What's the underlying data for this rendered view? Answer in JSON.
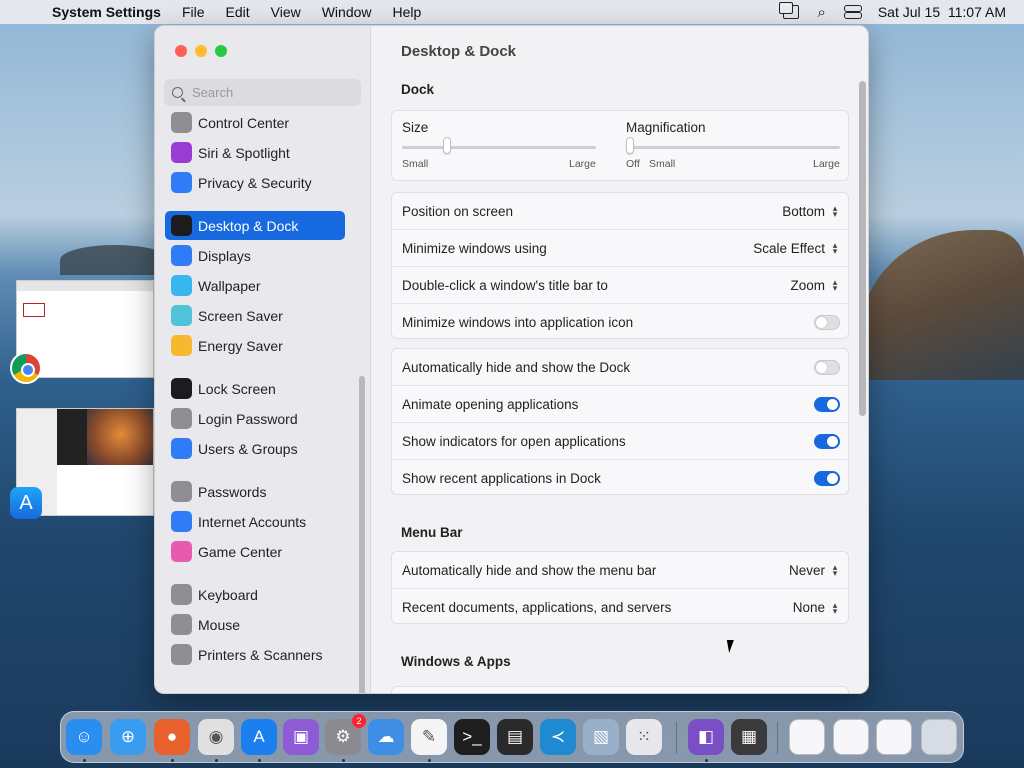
{
  "menubar": {
    "app_name": "System Settings",
    "items": [
      "File",
      "Edit",
      "View",
      "Window",
      "Help"
    ],
    "datetime": "Sat Jul 15  11:07 AM"
  },
  "sidebar": {
    "search_placeholder": "Search",
    "items": [
      {
        "label": "Control Center",
        "icon": "control-center-icon",
        "color": "#8e8e93"
      },
      {
        "label": "Siri & Spotlight",
        "icon": "siri-icon",
        "color": "#9b3bd6"
      },
      {
        "label": "Privacy & Security",
        "icon": "hand-icon",
        "color": "#2f7cf6"
      },
      {
        "label": "Desktop & Dock",
        "icon": "dock-icon",
        "color": "#1c1c1e",
        "selected": true
      },
      {
        "label": "Displays",
        "icon": "sun-icon",
        "color": "#2f7cf6"
      },
      {
        "label": "Wallpaper",
        "icon": "wallpaper-icon",
        "color": "#38b6f0"
      },
      {
        "label": "Screen Saver",
        "icon": "screen-saver-icon",
        "color": "#4fc3d9"
      },
      {
        "label": "Energy Saver",
        "icon": "bulb-icon",
        "color": "#f5b82e"
      },
      {
        "label": "Lock Screen",
        "icon": "lock-icon",
        "color": "#1c1c1e"
      },
      {
        "label": "Login Password",
        "icon": "login-lock-icon",
        "color": "#8e8e93"
      },
      {
        "label": "Users & Groups",
        "icon": "users-icon",
        "color": "#2f7cf6"
      },
      {
        "label": "Passwords",
        "icon": "key-icon",
        "color": "#8e8e93"
      },
      {
        "label": "Internet Accounts",
        "icon": "at-icon",
        "color": "#2f7cf6"
      },
      {
        "label": "Game Center",
        "icon": "game-center-icon",
        "color": "#e85ab0"
      },
      {
        "label": "Keyboard",
        "icon": "keyboard-icon",
        "color": "#8e8e93"
      },
      {
        "label": "Mouse",
        "icon": "mouse-icon",
        "color": "#8e8e93"
      },
      {
        "label": "Printers & Scanners",
        "icon": "printer-icon",
        "color": "#8e8e93"
      }
    ]
  },
  "content": {
    "title": "Desktop & Dock",
    "dock_section": "Dock",
    "size_label": "Size",
    "size_small": "Small",
    "size_large": "Large",
    "size_value": 0.23,
    "magnification_label": "Magnification",
    "mag_off": "Off",
    "mag_small": "Small",
    "mag_large": "Large",
    "mag_value": 0.0,
    "rows_group1": [
      {
        "label": "Position on screen",
        "value": "Bottom",
        "type": "popup"
      },
      {
        "label": "Minimize windows using",
        "value": "Scale Effect",
        "type": "popup"
      },
      {
        "label": "Double-click a window's title bar to",
        "value": "Zoom",
        "type": "popup"
      },
      {
        "label": "Minimize windows into application icon",
        "on": false,
        "type": "toggle"
      }
    ],
    "rows_group2": [
      {
        "label": "Automatically hide and show the Dock",
        "on": false,
        "type": "toggle"
      },
      {
        "label": "Animate opening applications",
        "on": true,
        "type": "toggle"
      },
      {
        "label": "Show indicators for open applications",
        "on": true,
        "type": "toggle"
      },
      {
        "label": "Show recent applications in Dock",
        "on": true,
        "type": "toggle"
      }
    ],
    "menubar_section": "Menu Bar",
    "rows_menubar": [
      {
        "label": "Automatically hide and show the menu bar",
        "value": "Never",
        "type": "popup"
      },
      {
        "label": "Recent documents, applications, and servers",
        "value": "None",
        "type": "popup"
      }
    ],
    "windows_section": "Windows & Apps"
  },
  "dock": {
    "apps": [
      {
        "name": "finder-icon",
        "color": "#2a8ef0",
        "glyph": "☺",
        "running": true
      },
      {
        "name": "safari-icon",
        "color": "#3a9cf0",
        "glyph": "⊕",
        "running": false
      },
      {
        "name": "firefox-icon",
        "color": "#e8602c",
        "glyph": "●",
        "running": true
      },
      {
        "name": "chrome-icon",
        "color": "#e0e0e0",
        "glyph": "◉",
        "running": true
      },
      {
        "name": "app-store-icon",
        "color": "#1b7ff0",
        "glyph": "A",
        "running": true
      },
      {
        "name": "podcasts-icon",
        "color": "#8e5ad6",
        "glyph": "▣",
        "running": false
      },
      {
        "name": "system-settings-icon",
        "color": "#8a8a90",
        "glyph": "⚙",
        "running": true,
        "badge": "2"
      },
      {
        "name": "weather-icon",
        "color": "#3f8ee6",
        "glyph": "☁",
        "running": false
      },
      {
        "name": "textedit-icon",
        "color": "#f4f4f4",
        "glyph": "✎",
        "running": true
      },
      {
        "name": "terminal-icon",
        "color": "#1e1e1e",
        "glyph": ">_",
        "running": false
      },
      {
        "name": "console-icon",
        "color": "#2a2a2a",
        "glyph": "▤",
        "running": false
      },
      {
        "name": "vscode-icon",
        "color": "#1f8ad2",
        "glyph": "≺",
        "running": false
      },
      {
        "name": "preview-icon",
        "color": "#9ab0c8",
        "glyph": "▧",
        "running": false
      },
      {
        "name": "launchpad-icon",
        "color": "#e8e8ec",
        "glyph": "⁙",
        "running": false
      },
      {
        "name": "visual-studio-icon",
        "color": "#7a4fc4",
        "glyph": "◧",
        "running": true
      },
      {
        "name": "calculator-icon",
        "color": "#3a3a3c",
        "glyph": "▦",
        "running": false
      }
    ],
    "recent": [
      "recent-window-1-icon",
      "recent-window-2-icon",
      "recent-window-3-icon",
      "trash-icon"
    ]
  }
}
